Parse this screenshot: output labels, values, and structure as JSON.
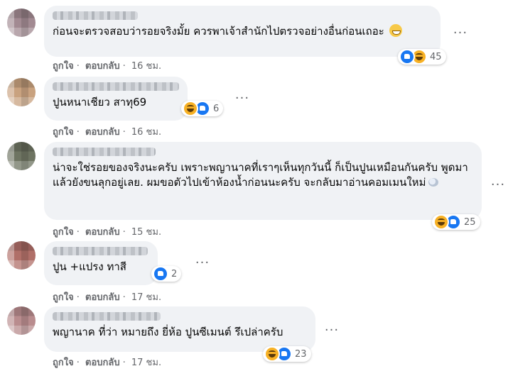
{
  "comments": [
    {
      "text": "ก่อนจะตรวจสอบว่ารอยจริงมั้ย ควรพาเจ้าสำนักไปตรวจอย่างอื่นก่อนเถอะ",
      "emoji": "grinning-emoji",
      "reactions": [
        "like",
        "haha"
      ],
      "reaction_count": "45",
      "like_label": "ถูกใจ",
      "reply_label": "ตอบกลับ",
      "time": "16 ชม."
    },
    {
      "text": "ปูนหนาเชียว สาทุ69",
      "reactions": [
        "haha",
        "like"
      ],
      "reaction_count": "6",
      "like_label": "ถูกใจ",
      "reply_label": "ตอบกลับ",
      "time": "16 ชม."
    },
    {
      "text": "น่าจะใช่รอยของจริงนะครับ เพราะพญานาคที่เราๆเห็นทุกวันนี้ ก็เป็นปูนเหมือนกันครับ พูดมาแล้วยังขนลุกอยู่เลย. ผมขอตัวไปเข้าห้องน้ำก่อนนะครับ จะกลับมาอ่านคอมเมนใหม่",
      "emoji": "speech-bubble-emoji",
      "reactions": [
        "haha",
        "like"
      ],
      "reaction_count": "25",
      "like_label": "ถูกใจ",
      "reply_label": "ตอบกลับ",
      "time": "15 ชม."
    },
    {
      "text": "ปูน +แปรง ทาสี",
      "reactions": [
        "like"
      ],
      "reaction_count": "2",
      "like_label": "ถูกใจ",
      "reply_label": "ตอบกลับ",
      "time": "17 ชม."
    },
    {
      "text": "พญานาค ที่ว่า หมายถึง ยี่ห้อ ปูนซีเมนต์ รึเปล่าครับ",
      "reactions": [
        "haha",
        "like"
      ],
      "reaction_count": "23",
      "like_label": "ถูกใจ",
      "reply_label": "ตอบกลับ",
      "time": "17 ชม."
    }
  ],
  "more_options_label": "···"
}
